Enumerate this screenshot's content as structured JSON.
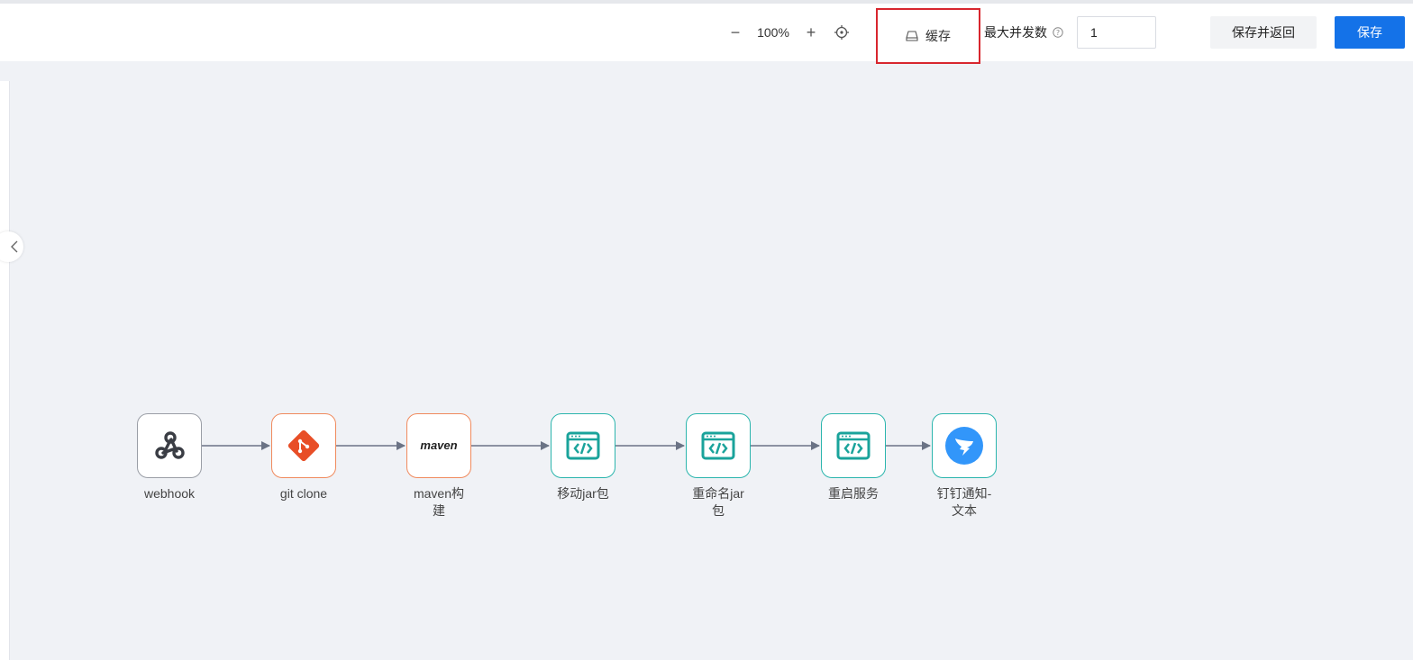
{
  "toolbar": {
    "zoom_out": "−",
    "zoom_level": "100%",
    "zoom_in": "+",
    "cache_label": "缓存",
    "max_concurrency_label": "最大并发数",
    "max_concurrency_value": "1",
    "save_and_return_label": "保存并返回",
    "save_label": "保存"
  },
  "colors": {
    "primary": "#1472e8",
    "highlight_border": "#d8262e",
    "node_gray": "#9a9ea6",
    "node_orange": "#f08a5d",
    "node_teal": "#2bb5ad",
    "edge": "#6b7385",
    "canvas_bg": "#f0f2f6"
  },
  "pipeline": {
    "nodes": [
      {
        "label": "webhook",
        "icon": "webhook-icon"
      },
      {
        "label": "git clone",
        "icon": "git-icon"
      },
      {
        "label": "maven构\n建",
        "icon": "maven-logo-icon",
        "logo_text": "maven"
      },
      {
        "label": "移动jar包",
        "icon": "code-window-icon"
      },
      {
        "label": "重命名jar\n包",
        "icon": "code-window-icon"
      },
      {
        "label": "重启服务",
        "icon": "code-window-icon"
      },
      {
        "label": "钉钉通知-\n文本",
        "icon": "dingtalk-icon"
      }
    ]
  }
}
